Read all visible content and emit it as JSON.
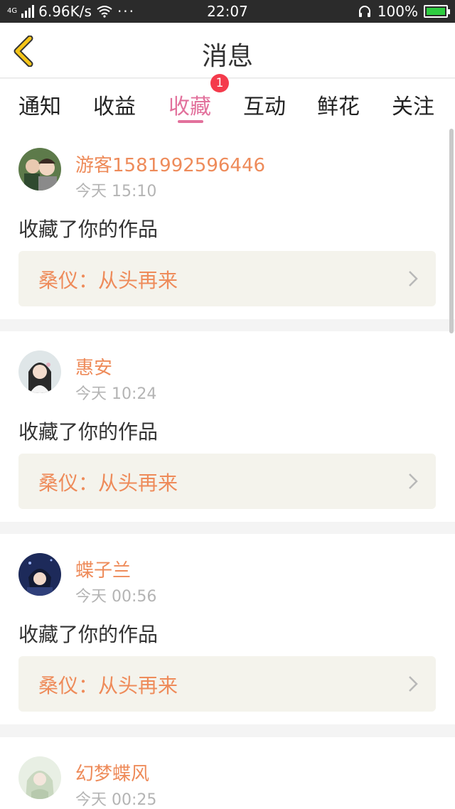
{
  "status_bar": {
    "network": "4G",
    "speed": "6.96K/s",
    "more": "···",
    "time": "22:07",
    "battery": "100%"
  },
  "header": {
    "title": "消息",
    "back_icon": "chevron-left-icon",
    "accent_color": "#f5c518"
  },
  "tabs": {
    "items": [
      {
        "label": "通知"
      },
      {
        "label": "收益"
      },
      {
        "label": "收藏"
      },
      {
        "label": "互动"
      },
      {
        "label": "鲜花"
      },
      {
        "label": "关注"
      }
    ],
    "active_index": 2,
    "active_color": "#e2719c",
    "badge": "1"
  },
  "messages": [
    {
      "user": "游客1581992596446",
      "time": "今天 15:10",
      "action": "收藏了你的作品",
      "work": "桑仪：从头再来"
    },
    {
      "user": "惠安",
      "time": "今天 10:24",
      "action": "收藏了你的作品",
      "work": "桑仪：从头再来"
    },
    {
      "user": "蝶子兰",
      "time": "今天 00:56",
      "action": "收藏了你的作品",
      "work": "桑仪：从头再来"
    },
    {
      "user": "幻梦蝶风",
      "time": "今天 00:25"
    }
  ],
  "colors": {
    "name": "#ee8b5a",
    "work_bg": "#f4f3ec",
    "badge": "#f43b4c"
  }
}
